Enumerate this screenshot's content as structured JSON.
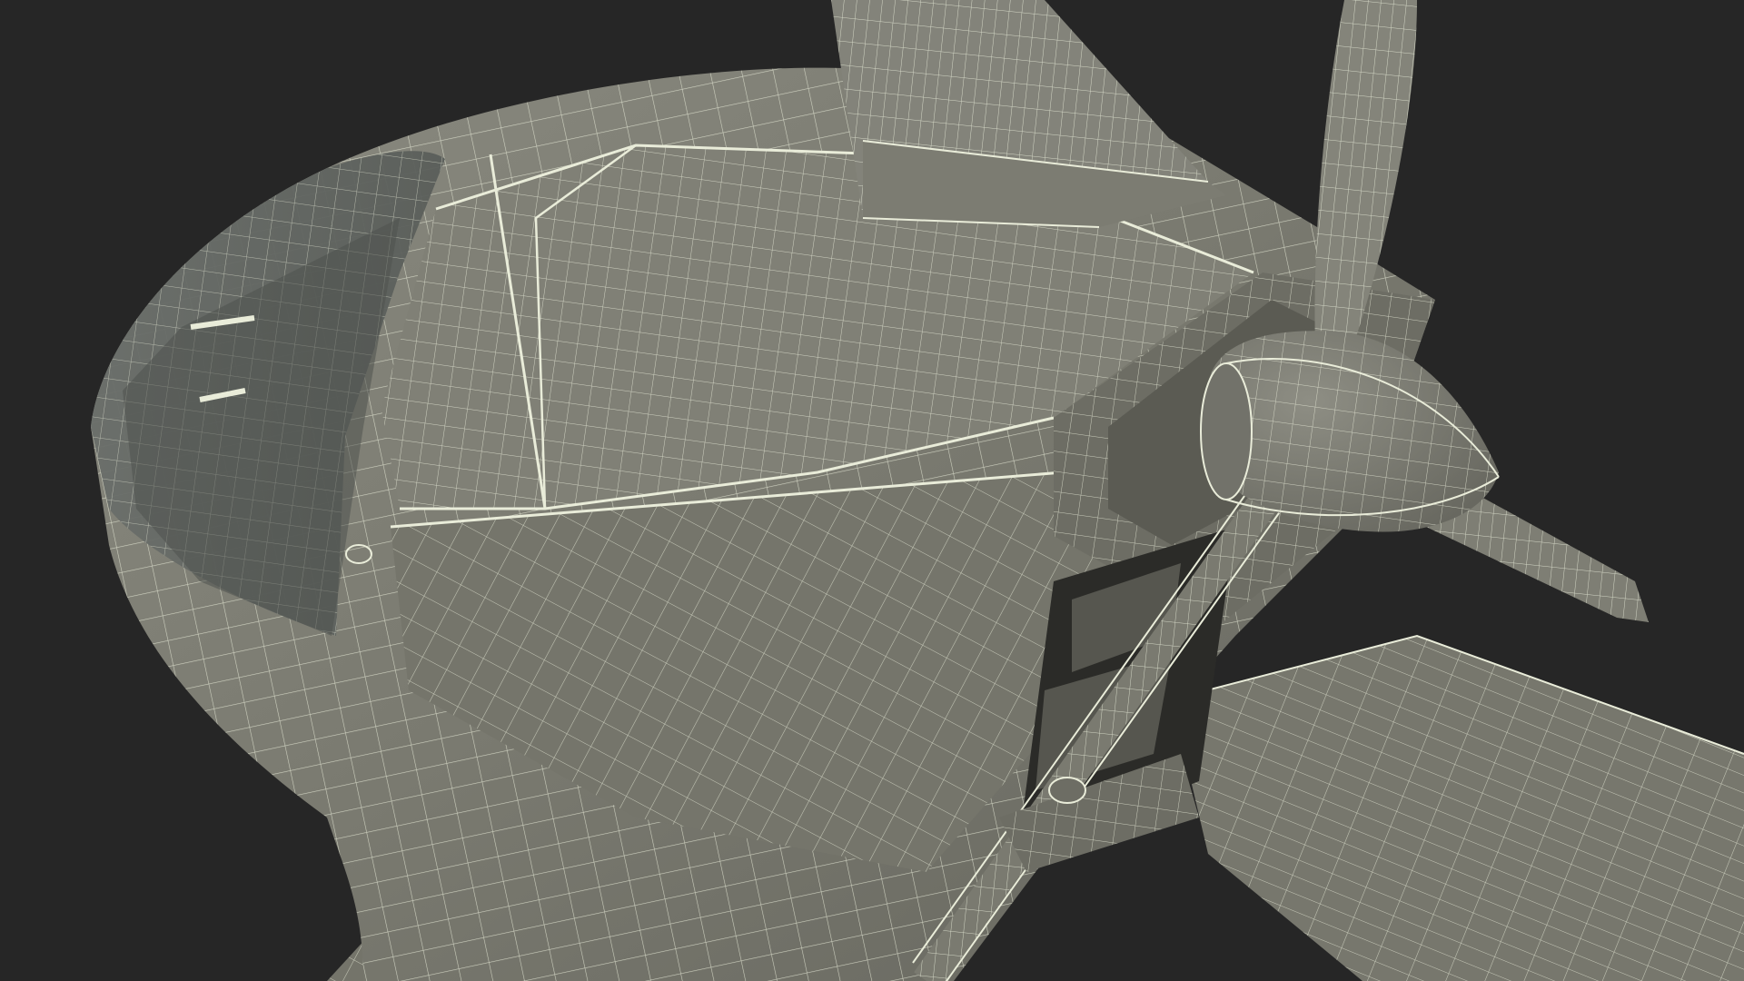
{
  "scene": {
    "subject": "aircraft-nose-wireframe",
    "colors": {
      "background": "#262626",
      "surface": "#7a7a70",
      "surface_dark": "#5f5f57",
      "surface_light": "#8c8c82",
      "glass": "#6d716c",
      "wire": "#e9ecd9",
      "cavity": "#2b2b28"
    }
  }
}
